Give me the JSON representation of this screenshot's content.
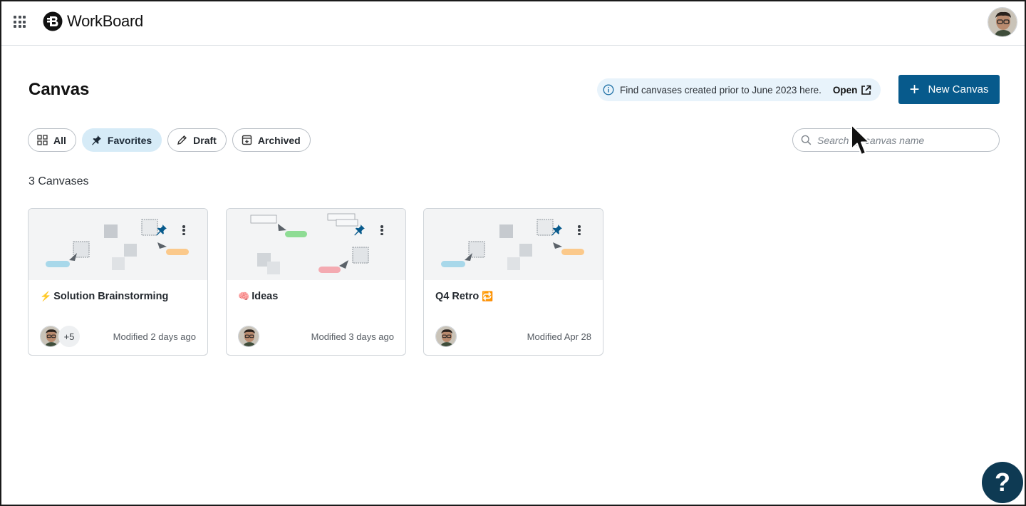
{
  "header": {
    "brand": "WorkBoard",
    "icons": {
      "apps": "apps-grid-icon",
      "avatar": "user-avatar"
    }
  },
  "page": {
    "title": "Canvas",
    "notice": {
      "text": "Find canvases created prior to June 2023 here.",
      "link_label": "Open",
      "icons": [
        "info-icon",
        "external-link-icon"
      ]
    },
    "new_button": {
      "label": "New Canvas",
      "icon": "plus-icon"
    }
  },
  "filters": [
    {
      "label": "All",
      "icon": "grid-icon",
      "active": false
    },
    {
      "label": "Favorites",
      "icon": "pin-icon",
      "active": true
    },
    {
      "label": "Draft",
      "icon": "pencil-icon",
      "active": false
    },
    {
      "label": "Archived",
      "icon": "archive-icon",
      "active": false
    }
  ],
  "search": {
    "placeholder": "Search by canvas name"
  },
  "count_label": "3 Canvases",
  "cards": [
    {
      "emoji": "⚡",
      "title": "Solution Brainstorming",
      "extra_members": "+5",
      "modified": "Modified 2 days ago",
      "pinned": true
    },
    {
      "emoji": "🧠",
      "title": "Ideas",
      "extra_members": "",
      "modified": "Modified 3 days ago",
      "pinned": true
    },
    {
      "emoji": "🔁",
      "title": "Q4 Retro",
      "emoji_after": true,
      "extra_members": "",
      "modified": "Modified Apr 28",
      "pinned": true
    }
  ],
  "help_label": "?",
  "colors": {
    "primary": "#075a8c",
    "notice_bg": "#e8f3fb",
    "chip_active": "#d6ebf7",
    "help_bg": "#0e3a53"
  }
}
